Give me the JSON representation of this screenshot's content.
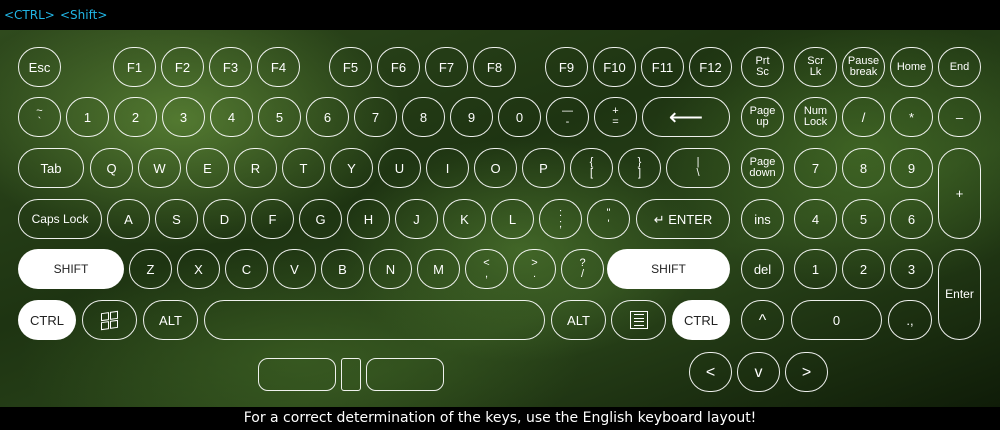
{
  "modifiers": [
    "<CTRL>",
    "<Shift>"
  ],
  "footer": "For a correct determination of the keys, use the English keyboard layout!",
  "rows": {
    "fn": [
      "Esc",
      "F1",
      "F2",
      "F3",
      "F4",
      "F5",
      "F6",
      "F7",
      "F8",
      "F9",
      "F10",
      "F11",
      "F12",
      "Prt\nSc",
      "Scr\nLk",
      "Pause\nbreak",
      "Home",
      "End"
    ],
    "num": [
      "~\n`",
      "1",
      "2",
      "3",
      "4",
      "5",
      "6",
      "7",
      "8",
      "9",
      "0",
      "—\n-",
      "+\n=",
      "⟵",
      "Page\nup",
      "Num\nLock",
      "/",
      "*",
      "–"
    ],
    "q": [
      "Tab",
      "Q",
      "W",
      "E",
      "R",
      "T",
      "Y",
      "U",
      "I",
      "O",
      "P",
      "{\n[",
      "}\n]",
      "|\n\\",
      "Page\ndown",
      "7",
      "8",
      "9",
      "+"
    ],
    "a": [
      "Caps Lock",
      "A",
      "S",
      "D",
      "F",
      "G",
      "H",
      "J",
      "K",
      "L",
      ":\n;",
      "\"\n'",
      "↵ ENTER",
      "ins",
      "4",
      "5",
      "6"
    ],
    "z": [
      "SHIFT",
      "Z",
      "X",
      "C",
      "V",
      "B",
      "N",
      "M",
      "<\n,",
      ">\n.",
      "?\n/",
      "SHIFT",
      "del",
      "1",
      "2",
      "3",
      "Enter"
    ],
    "bottom": [
      "CTRL",
      "windows",
      "ALT",
      "",
      "ALT",
      "menu",
      "CTRL",
      "^",
      "0",
      ".,"
    ],
    "arrows": [
      "<",
      "v",
      ">"
    ]
  }
}
